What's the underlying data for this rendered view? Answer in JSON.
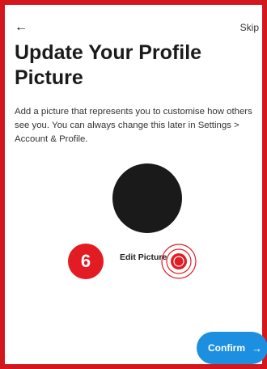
{
  "header": {
    "back_icon": "←",
    "skip_label": "Skip"
  },
  "title": "Update Your Profile Picture",
  "description": "Add a picture that represents you to customise how others see you. You can always change this later in Settings > Account & Profile.",
  "avatar": {
    "color": "#1a1a1a"
  },
  "edit_picture_label": "Edit Picture",
  "annotation": {
    "step_number": "6",
    "color": "#e31b23"
  },
  "confirm": {
    "label": "Confirm",
    "arrow": "→",
    "color": "#1d8fe0"
  }
}
